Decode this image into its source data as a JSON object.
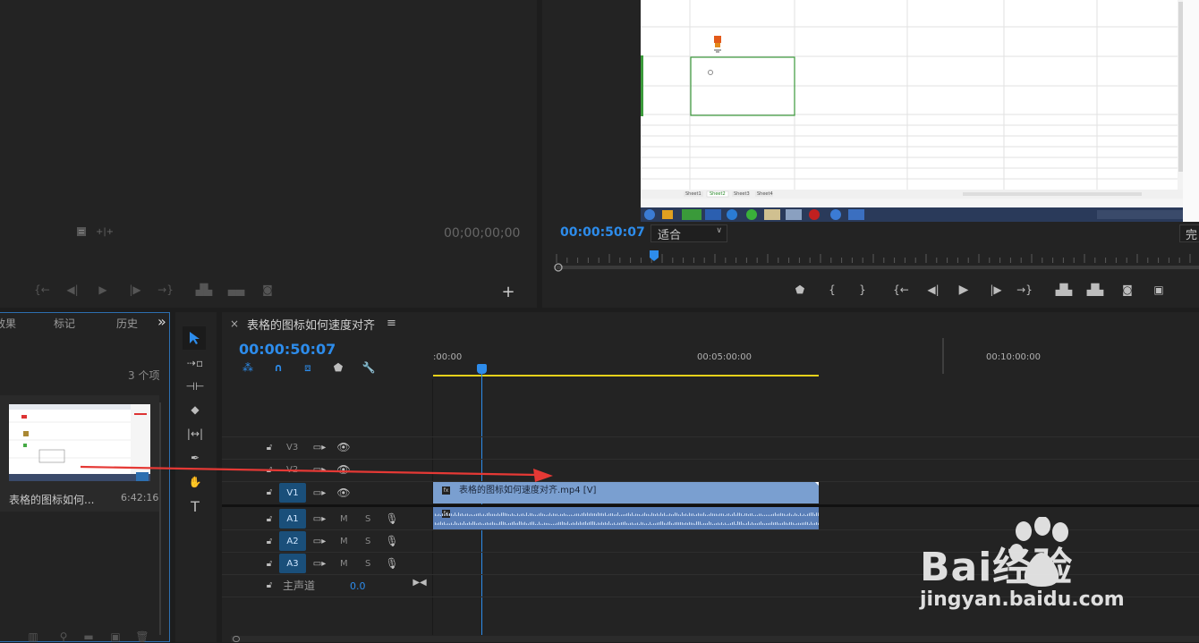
{
  "source_monitor": {
    "timecode": "00;00;00;00"
  },
  "program_monitor": {
    "timecode": "00:00:50:07",
    "zoom_select": "适合",
    "quality_partial": "完",
    "sheet_tabs": [
      "Sheet1",
      "Sheet2",
      "Sheet3",
      "Sheet4"
    ]
  },
  "project_panel": {
    "tabs": [
      "效果",
      "标记",
      "历史"
    ],
    "overflow": "»",
    "item_count": "3 个项",
    "clip_name": "表格的图标如何...",
    "clip_duration": "6:42:16"
  },
  "timeline": {
    "close": "×",
    "title": "表格的图标如何速度对齐",
    "menu": "≡",
    "timecode": "00:00:50:07",
    "ruler_labels": [
      ":00:00",
      "00:05:00:00",
      "00:10:00:00"
    ],
    "video_tracks": [
      "V3",
      "V2",
      "V1"
    ],
    "audio_tracks": [
      "A1",
      "A2",
      "A3"
    ],
    "mute": "M",
    "solo": "S",
    "master_label": "主声道",
    "master_value": "0.0",
    "video_clip_name": "表格的图标如何速度对齐.mp4 [V]",
    "fx": "fx"
  },
  "watermark": {
    "text": "Bai经验",
    "url": "jingyan.baidu.com"
  },
  "colors": {
    "accent_blue": "#2d8ceb",
    "clip_video": "#7a9fd0",
    "clip_audio": "#5a7fb8",
    "work_area": "#e6d21a",
    "arrow": "#e53935"
  }
}
